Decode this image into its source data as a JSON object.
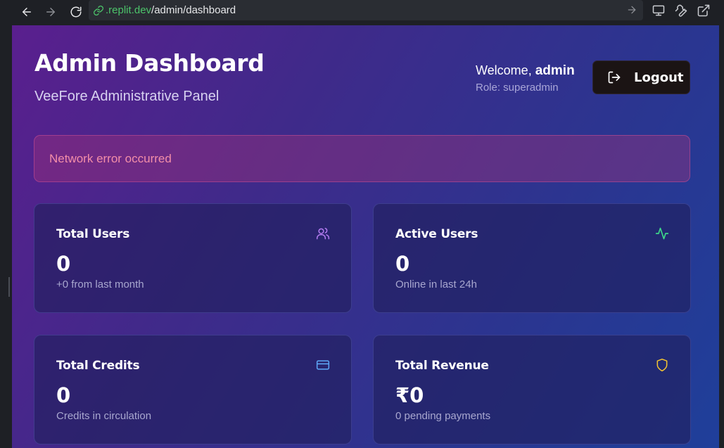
{
  "browser": {
    "url_domain": ".replit.dev",
    "url_path": "/admin/dashboard",
    "icons": {
      "back": "arrow-left-icon",
      "forward": "arrow-right-icon",
      "reload": "reload-icon",
      "secure": "link-icon",
      "go": "arrow-right-icon",
      "device": "monitor-icon",
      "tools": "wrench-icon",
      "open_external": "external-link-icon"
    }
  },
  "header": {
    "title": "Admin Dashboard",
    "subtitle": "VeeFore Administrative Panel",
    "welcome_prefix": "Welcome,",
    "username": "admin",
    "role": "Role: superadmin",
    "logout_label": "Logout"
  },
  "alert": {
    "message": "Network error occurred",
    "color": "#f38ea8"
  },
  "stats": [
    {
      "label": "Total Users",
      "value": "0",
      "sub": "+0 from last month",
      "icon": "users-icon",
      "icon_color": "#b57cf2"
    },
    {
      "label": "Active Users",
      "value": "0",
      "sub": "Online in last 24h",
      "icon": "activity-icon",
      "icon_color": "#3ed88a"
    },
    {
      "label": "Total Credits",
      "value": "0",
      "sub": "Credits in circulation",
      "icon": "credit-card-icon",
      "icon_color": "#5ea8f8"
    },
    {
      "label": "Total Revenue",
      "value": "₹0",
      "sub": "0 pending payments",
      "icon": "shield-icon",
      "icon_color": "#f5c531"
    }
  ],
  "colors": {
    "background_start": "#5a1f8e",
    "background_end": "#1f3f9a",
    "scrollbar": "#28a7f5",
    "url_domain": "#4cc36a"
  }
}
